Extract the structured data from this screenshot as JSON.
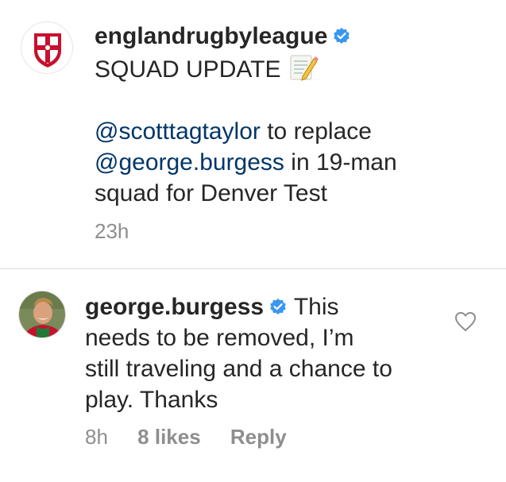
{
  "post": {
    "username": "englandrugbyleague",
    "title": "SQUAD UPDATE",
    "mention1": "@scotttagtaylor",
    "text1": " to replace",
    "mention2": "@george.burgess",
    "text2": " in 19-man",
    "text3": "squad for Denver Test",
    "timestamp": "23h"
  },
  "comment": {
    "username": "george.burgess",
    "line1_tail": "This",
    "line2": "needs to be removed, I’m",
    "line3": "still traveling and a chance to",
    "line4": "play. Thanks",
    "timestamp": "8h",
    "likes": "8 likes",
    "reply": "Reply"
  },
  "icons": {
    "verified": "verified-badge-icon",
    "memo": "memo-emoji-icon",
    "like": "heart-outline-icon"
  },
  "colors": {
    "verified": "#3897f0",
    "mention": "#003569",
    "meta": "#8e8e8e",
    "crest_red": "#c8102e"
  }
}
